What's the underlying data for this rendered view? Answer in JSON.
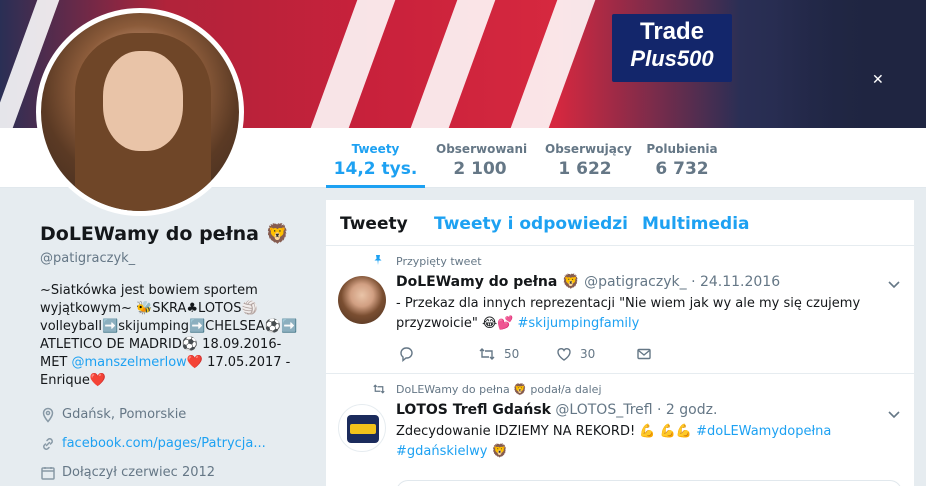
{
  "banner": {
    "sponsor_top": "Trade",
    "sponsor_bottom": "Plus500",
    "close_glyph": "✕"
  },
  "nav": {
    "stats": [
      {
        "label": "Tweety",
        "value": "14,2 tys."
      },
      {
        "label": "Obserwowani",
        "value": "2 100"
      },
      {
        "label": "Obserwujący",
        "value": "1 622"
      },
      {
        "label": "Polubienia",
        "value": "6 732"
      }
    ]
  },
  "profile": {
    "name": "DoLEWamy do pełna 🦁",
    "handle": "@patigraczyk_",
    "bio_part1": "~Siatkówka jest bowiem sportem wyjątkowym~ 🐝SKRA♣LOTOS🏐 volleyball➡️skijumping➡️CHELSEA⚽➡️ ATLETICO DE MADRID⚽ 18.09.2016-MET ",
    "bio_mention": "@manszelmerlow",
    "bio_part2": "❤️ 17.05.2017 - Enrique❤️",
    "location": "Gdańsk, Pomorskie",
    "website": "facebook.com/pages/Patrycja...",
    "joined": "Dołączył czerwiec 2012"
  },
  "timeline": {
    "tabs": [
      "Tweety",
      "Tweety i odpowiedzi",
      "Multimedia"
    ],
    "tweets": [
      {
        "context": "Przypięty tweet",
        "author": "DoLEWamy do pełna 🦁",
        "handle_date": "@patigraczyk_ · 24.11.2016",
        "text": "- Przekaz dla innych reprezentacji \"Nie wiem jak wy ale my się czujemy przyzwoicie\" 😂💕 ",
        "hashtag": "#skijumpingfamily",
        "retweets": "50",
        "likes": "30"
      },
      {
        "context": "DoLEWamy do pełna 🦁 podał/a dalej",
        "author": "LOTOS Trefl Gdańsk",
        "handle_date": "@LOTOS_Trefl · 2 godz.",
        "text": "Zdecydowanie IDZIEMY NA REKORD! 💪 💪💪 ",
        "hashtag": "#doLEWamydopełna",
        "hashtag2": "#gdańskielwy",
        "trail_emoji": "🦁"
      }
    ]
  },
  "colors": {
    "accent": "#1da1f2",
    "muted": "#657786",
    "background": "#e6ecf0"
  }
}
